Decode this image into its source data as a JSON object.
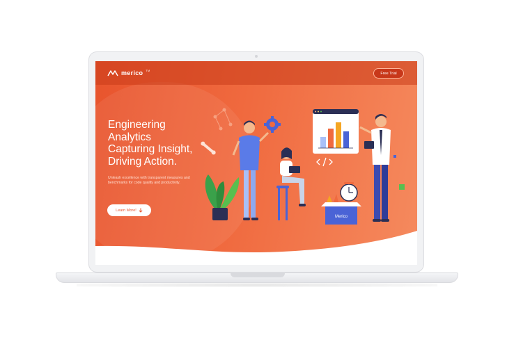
{
  "brand": {
    "name": "merico",
    "tm": "TM"
  },
  "nav": {
    "cta_label": "Free Trial"
  },
  "hero": {
    "headline_lines": [
      "Engineering",
      "Analytics",
      "Capturing Insight,",
      "Driving Action."
    ],
    "subtitle": "Unleash excellence with transparent measures and benchmarks for code quality and productivity.",
    "cta_label": "Learn More!"
  },
  "illustration": {
    "box_label": "Merico"
  },
  "colors": {
    "accent": "#e8542d",
    "accent_dark": "#c8381a",
    "white": "#ffffff"
  }
}
